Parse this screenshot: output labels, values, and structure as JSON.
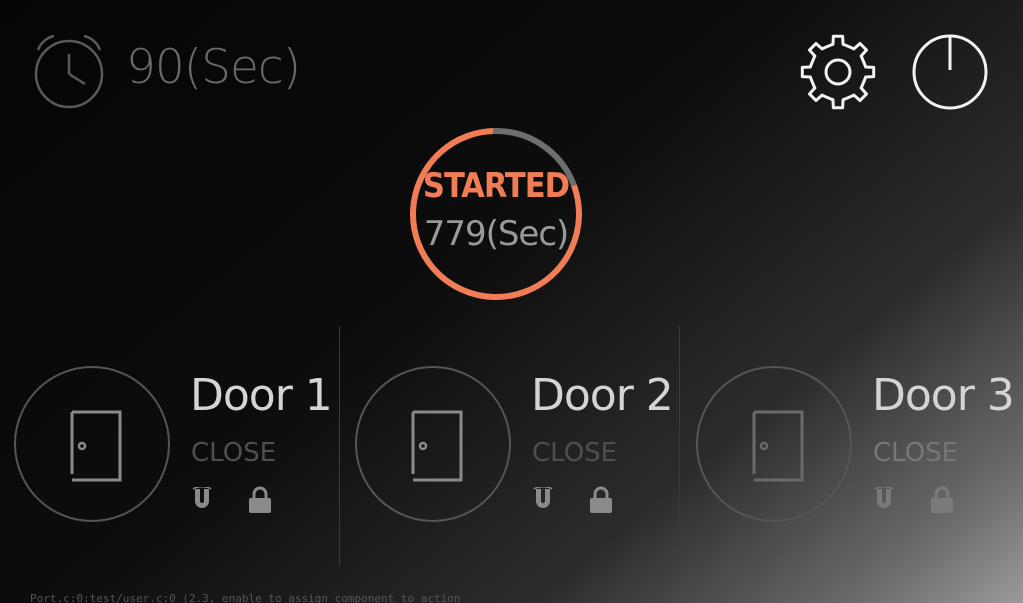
{
  "timer": {
    "value_label": "90(Sec)",
    "icon": "alarm-clock-icon"
  },
  "header": {
    "settings_icon": "gear-icon",
    "power_icon": "power-icon"
  },
  "status": {
    "label": "STARTED",
    "time_label": "779(Sec)",
    "progress_fraction": 0.8,
    "colors": {
      "accent": "#f17d56",
      "track": "#6e6e6e"
    }
  },
  "doors": [
    {
      "name": "Door 1",
      "state": "CLOSE",
      "door_icon": "door-icon",
      "magnet_icon": "magnet-icon",
      "lock_icon": "lock-icon"
    },
    {
      "name": "Door 2",
      "state": "CLOSE",
      "door_icon": "door-icon",
      "magnet_icon": "magnet-icon",
      "lock_icon": "lock-icon"
    },
    {
      "name": "Door 3",
      "state": "CLOSE",
      "door_icon": "door-icon",
      "magnet_icon": "magnet-icon",
      "lock_icon": "lock-icon"
    }
  ],
  "footer": {
    "text": "Port.c:0:test/user.c:0 (2.3, enable to assign component to action"
  }
}
